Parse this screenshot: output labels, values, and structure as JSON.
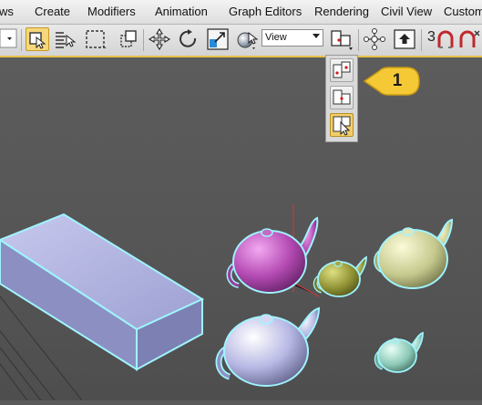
{
  "menu": {
    "items": [
      "ws",
      "Create",
      "Modifiers",
      "Animation",
      "Graph Editors",
      "Rendering",
      "Civil View",
      "Custom"
    ]
  },
  "toolbar": {
    "reference_coord_system": "View",
    "snap_count_label": "3"
  },
  "flyout": {
    "callout_number": "1",
    "selected_index": 2
  },
  "colors": {
    "active_button": "#f6d77a",
    "callout": "#f5c936",
    "selection_outline": "#9ff4ff"
  },
  "icons": [
    "select-object-icon",
    "select-by-name-icon",
    "rect-selection-region-icon",
    "window-crossing-icon",
    "move-icon",
    "rotate-icon",
    "scale-icon",
    "select-and-place-icon",
    "use-pivot-center-icon",
    "mirror-icon",
    "align-icon",
    "percent-snap-icon",
    "spinner-snap-icon"
  ]
}
